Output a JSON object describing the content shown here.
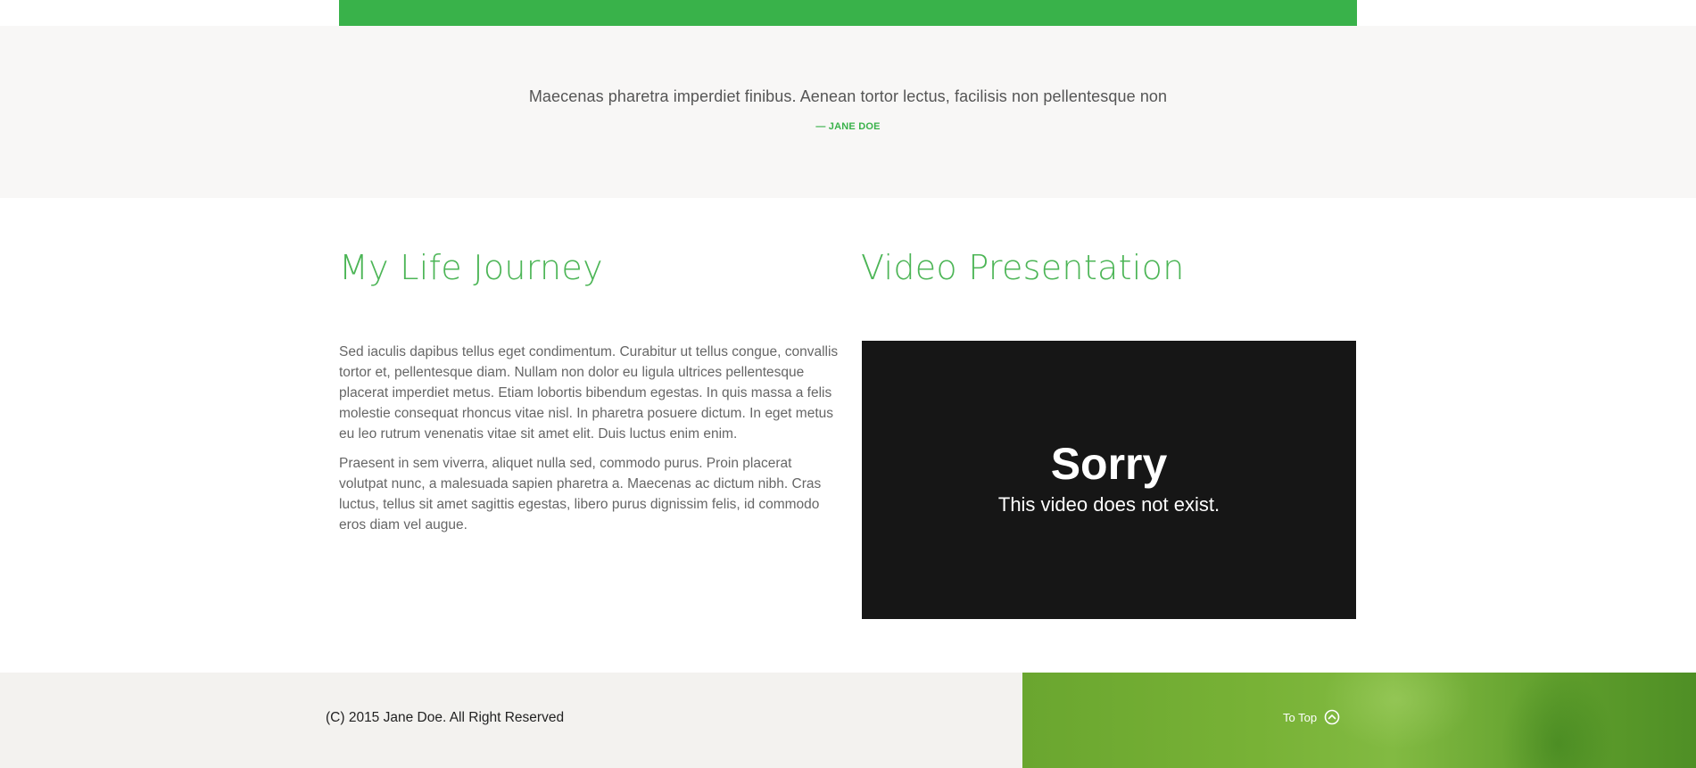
{
  "quote": {
    "text": "Maecenas pharetra imperdiet finibus. Aenean tortor lectus, facilisis non pellentesque non",
    "author": "— JANE DOE"
  },
  "journey": {
    "title": "My Life Journey",
    "paragraphs": [
      "Sed iaculis dapibus tellus eget condimentum. Curabitur ut tellus congue, convallis tortor et, pellentesque diam. Nullam non dolor eu ligula ultrices pellentesque placerat imperdiet metus. Etiam lobortis bibendum egestas. In quis massa a felis molestie consequat rhoncus vitae nisl. In pharetra posuere dictum. In eget metus eu leo rutrum venenatis vitae sit amet elit. Duis luctus enim enim.",
      "Praesent in sem viverra, aliquet nulla sed, commodo purus. Proin placerat volutpat nunc, a malesuada sapien pharetra a. Maecenas ac dictum nibh. Cras luctus, tellus sit amet sagittis egestas, libero purus dignissim felis, id commodo eros diam vel augue."
    ]
  },
  "video": {
    "title": "Video Presentation",
    "error_heading": "Sorry",
    "error_message": "This video does not exist."
  },
  "footer": {
    "copyright": "(C) 2015 Jane Doe. All Right Reserved",
    "to_top_label": "To Top",
    "to_top_icon": "chevron-up-circle-icon"
  },
  "colors": {
    "accent": "#39b24a",
    "heading": "#4cb556",
    "quote_band": "#f8f7f6",
    "video_bg": "#161616"
  }
}
